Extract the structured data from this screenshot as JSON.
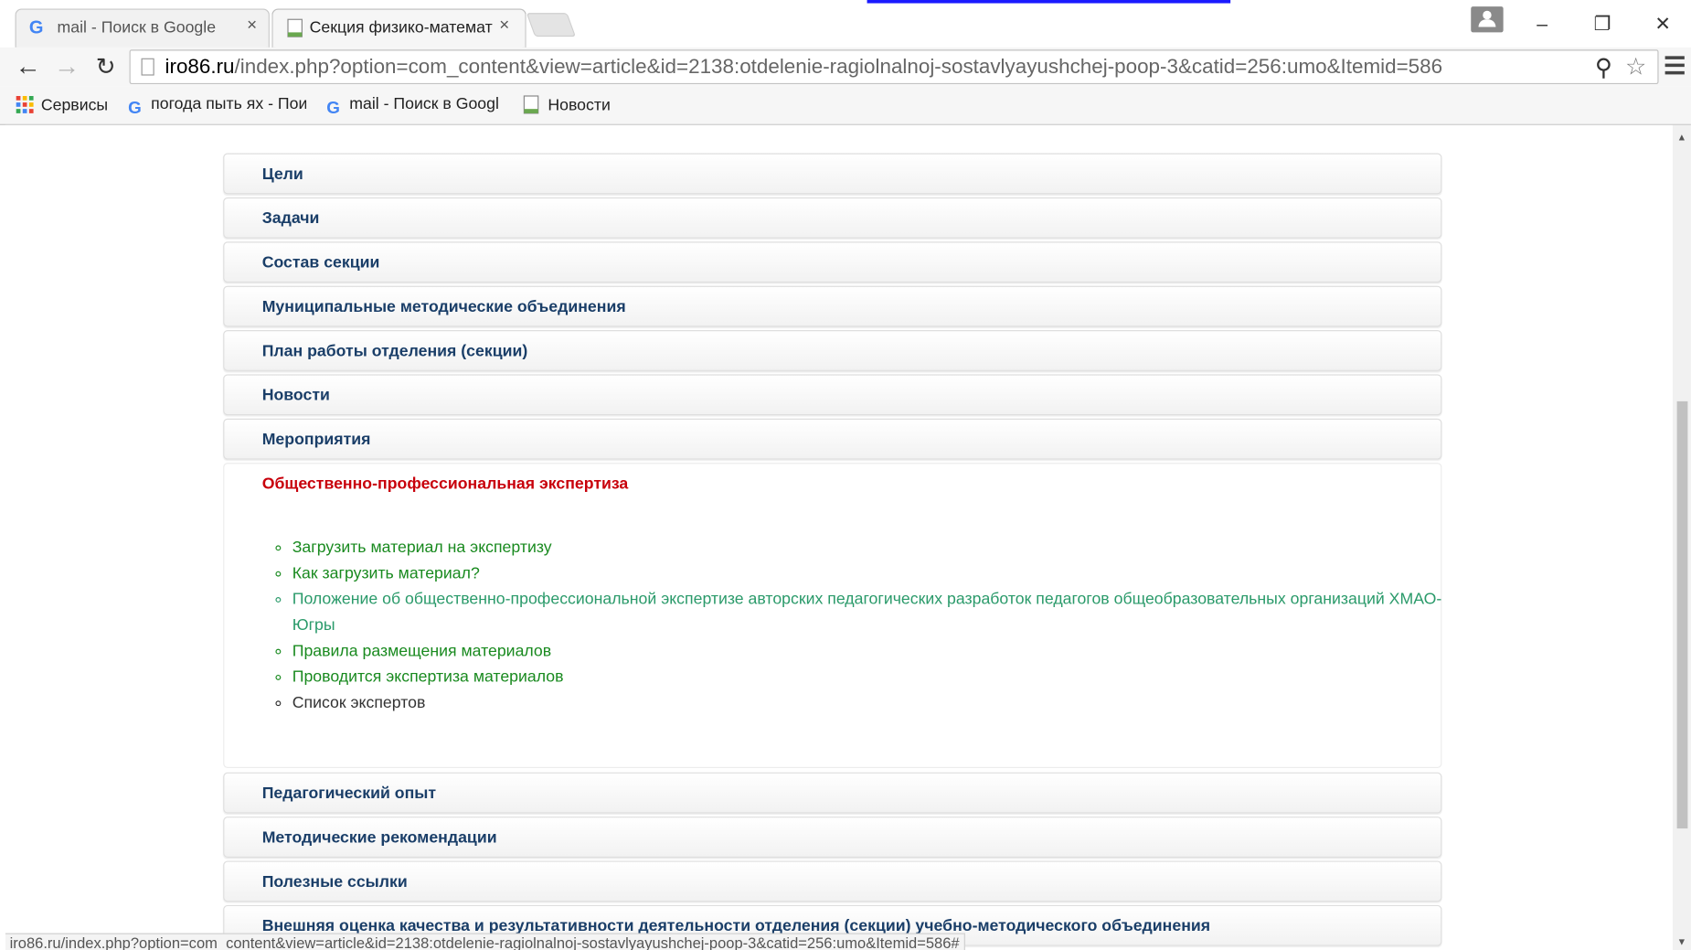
{
  "browser": {
    "tabs": [
      {
        "title": "mail - Поиск в Google",
        "icon": "google-g-icon",
        "active": false
      },
      {
        "title": "Секция физико-математ",
        "icon": "page-favicon",
        "active": true
      }
    ],
    "close_glyph": "×",
    "window_buttons": {
      "minimize": "–",
      "restore": "❐",
      "close": "✕"
    },
    "toolbar": {
      "back": "←",
      "forward": "→",
      "reload": "↻",
      "url_host": "iro86.ru",
      "url_path": "/index.php?option=com_content&view=article&id=2138:otdelenie-ragiolnalnoj-sostavlyayushchej-poop-3&catid=256:umo&Itemid=586",
      "zoom_glyph": "⚲",
      "star_glyph": "☆"
    },
    "bookmarks": [
      {
        "label": "Сервисы",
        "icon": "apps-grid-icon"
      },
      {
        "label": "погода пыть ях - Пои",
        "icon": "google-g-icon"
      },
      {
        "label": "mail - Поиск в Googl",
        "icon": "google-g-icon"
      },
      {
        "label": "Новости",
        "icon": "page-favicon"
      }
    ],
    "google_glyph": "G",
    "status_url": "iro86.ru/index.php?option=com_content&view=article&id=2138:otdelenie-ragiolnalnoj-sostavlyayushchej-poop-3&catid=256:umo&Itemid=586#"
  },
  "accordion": {
    "sections_before": [
      {
        "label": "Цели"
      },
      {
        "label": "Задачи"
      },
      {
        "label": "Состав секции"
      },
      {
        "label": "Муниципальные методические объединения"
      },
      {
        "label": "План работы отделения (секции)"
      },
      {
        "label": "Новости"
      },
      {
        "label": "Мероприятия"
      }
    ],
    "open_section": {
      "label": "Общественно-профессиональная экспертиза",
      "items": [
        {
          "text": "Загрузить материал на экспертизу",
          "style": "green"
        },
        {
          "text": "Как загрузить материал?",
          "style": "green"
        },
        {
          "text": "Положение об общественно-профессиональной экспертизе авторских педагогических разработок педагогов общеобразовательных организаций ХМАО-Югры",
          "style": "teal"
        },
        {
          "text": "Правила размещения материалов",
          "style": "green"
        },
        {
          "text": "Проводится экспертиза материалов",
          "style": "green"
        },
        {
          "text": "Список экспертов",
          "style": "plain"
        }
      ]
    },
    "sections_after": [
      {
        "label": "Педагогический опыт"
      },
      {
        "label": "Методические рекомендации"
      },
      {
        "label": "Полезные ссылки"
      },
      {
        "label": "Внешняя оценка качества и результативности деятельности отделения (секции) учебно-методического объединения"
      }
    ]
  },
  "colors": {
    "section_title": "#1a3e68",
    "open_title": "#c8000b",
    "link_green": "#198a1f",
    "link_teal": "#2a9a6a"
  }
}
